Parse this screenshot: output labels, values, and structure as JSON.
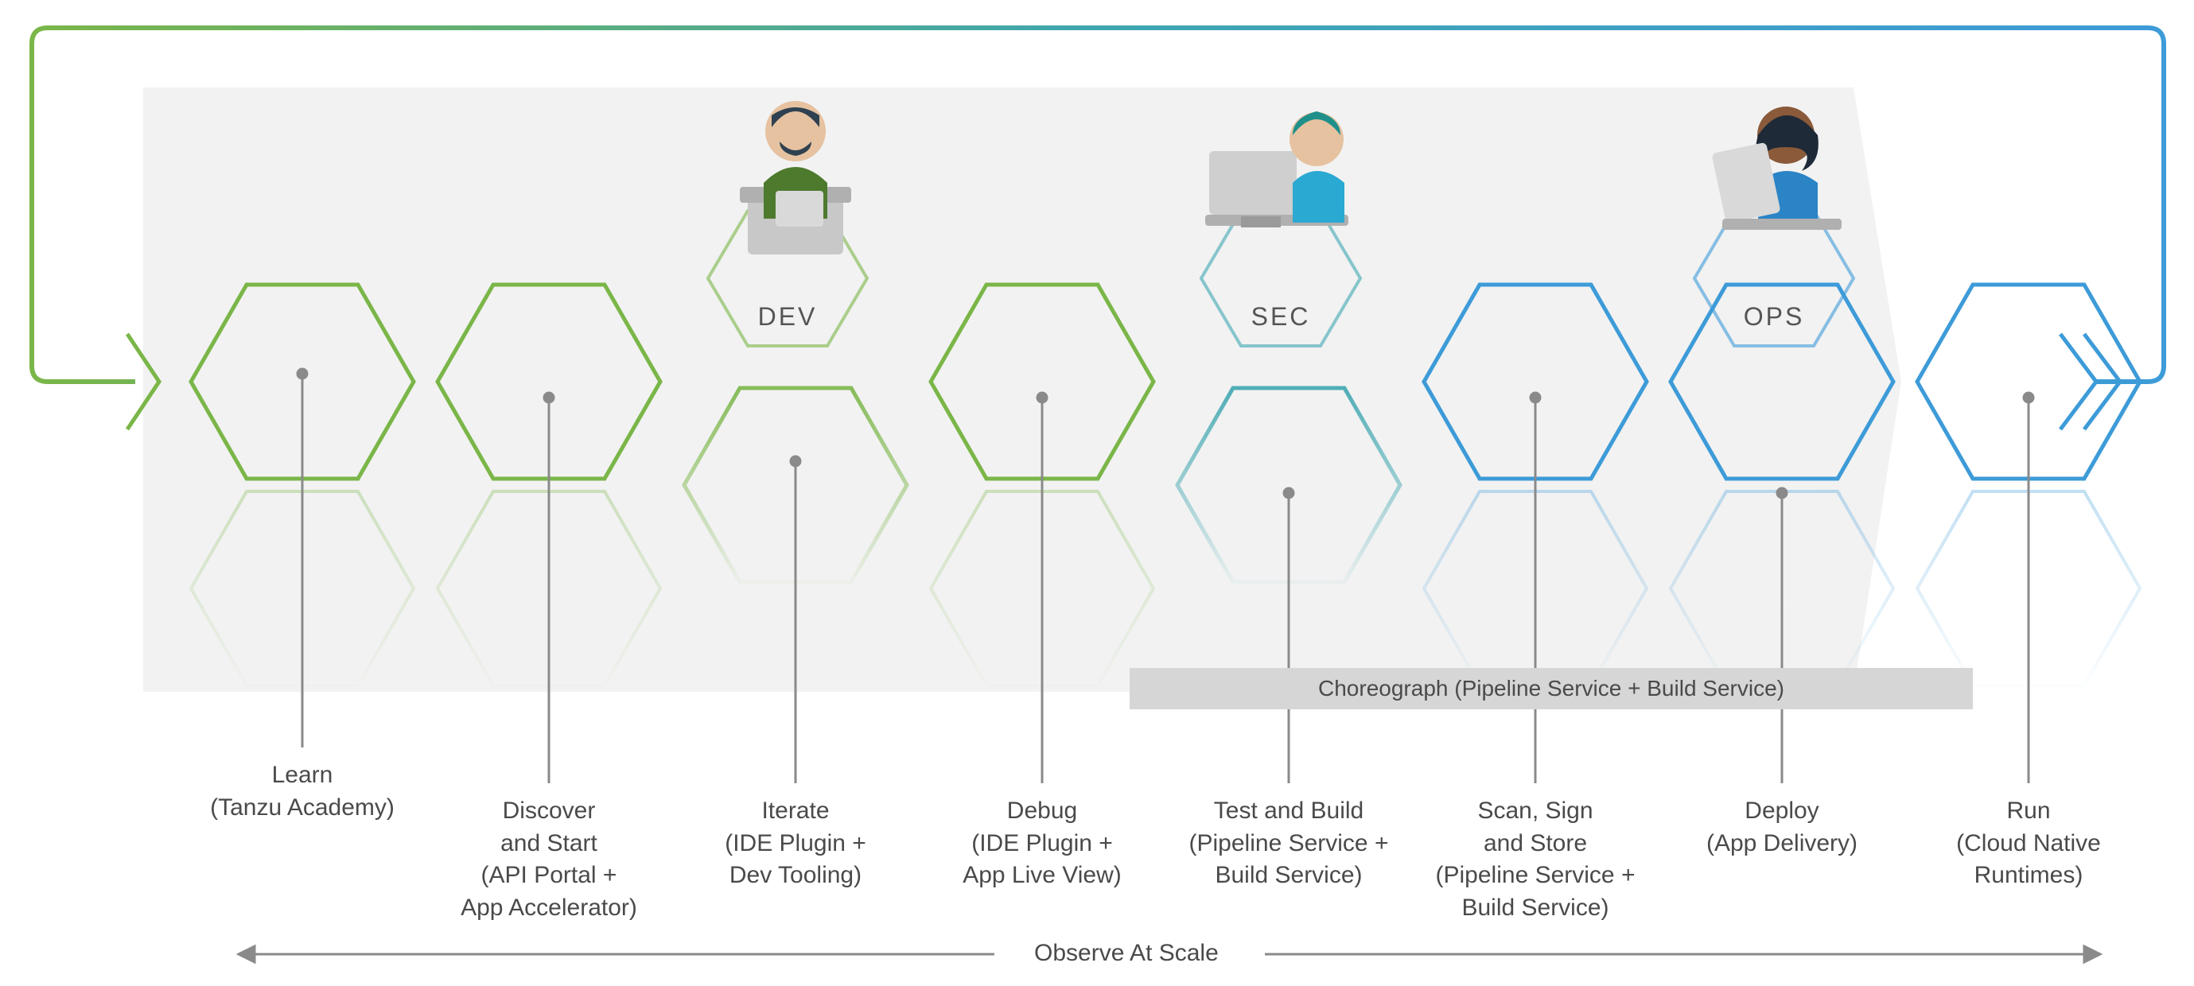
{
  "roles": {
    "dev": "DEV",
    "sec": "SEC",
    "ops": "OPS"
  },
  "choreograph": "Choreograph (Pipeline Service + Build Service)",
  "observe": "Observe At Scale",
  "steps": {
    "learn": {
      "title": "Learn",
      "desc": "(Tanzu Academy)"
    },
    "discover": {
      "title": "Discover",
      "l2": "and Start",
      "l3": "(API Portal +",
      "l4": "App Accelerator)"
    },
    "iterate": {
      "title": "Iterate",
      "l2": "(IDE Plugin +",
      "l3": "Dev Tooling)"
    },
    "debug": {
      "title": "Debug",
      "l2": "(IDE Plugin +",
      "l3": "App Live View)"
    },
    "test": {
      "title": "Test and Build",
      "l2": "(Pipeline Service +",
      "l3": "Build Service)"
    },
    "scan": {
      "title": "Scan, Sign",
      "l2": "and Store",
      "l3": "(Pipeline Service +",
      "l4": "Build Service)"
    },
    "deploy": {
      "title": "Deploy",
      "l2": "(App Delivery)"
    },
    "run": {
      "title": "Run",
      "l2": "(Cloud Native",
      "l3": "Runtimes)"
    }
  },
  "colors": {
    "green": "#7ab648",
    "teal": "#3ea6b0",
    "blue": "#3d9bd8",
    "grayHex": "#8a8a8a",
    "bgGray": "#f2f2f2"
  }
}
